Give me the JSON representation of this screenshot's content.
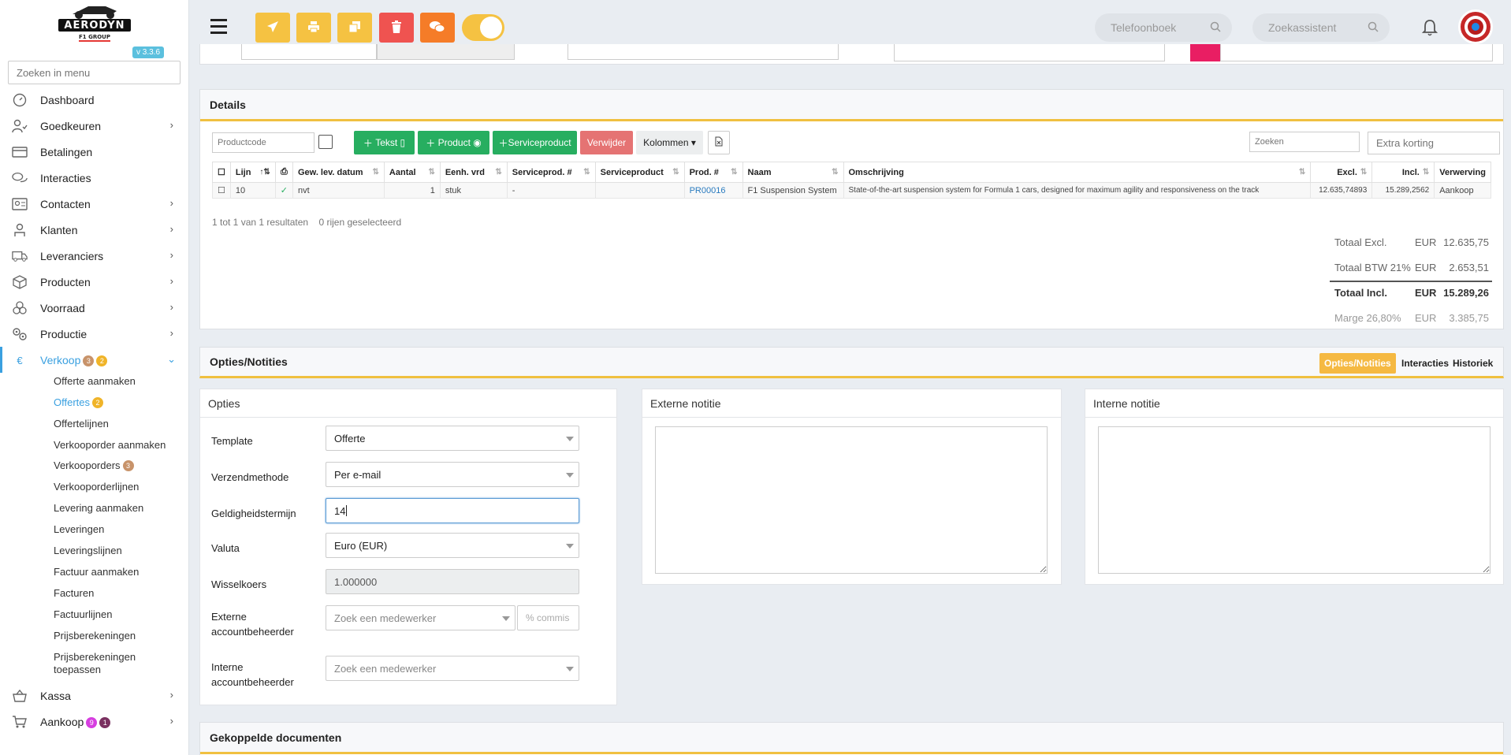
{
  "sidebar": {
    "logo_text": "AERODYN",
    "logo_subtext": "F1 GROUP",
    "version": "v 3.3.6",
    "search_placeholder": "Zoeken in menu",
    "items": [
      {
        "label": "Dashboard",
        "icon": "dashboard-icon"
      },
      {
        "label": "Goedkeuren",
        "icon": "user-check-icon"
      },
      {
        "label": "Betalingen",
        "icon": "card-icon"
      },
      {
        "label": "Interacties",
        "icon": "chat-icon"
      },
      {
        "label": "Contacten",
        "icon": "contact-card-icon"
      },
      {
        "label": "Klanten",
        "icon": "person-icon"
      },
      {
        "label": "Leveranciers",
        "icon": "truck-icon"
      },
      {
        "label": "Producten",
        "icon": "box-icon"
      },
      {
        "label": "Voorraad",
        "icon": "stock-icon"
      },
      {
        "label": "Productie",
        "icon": "gears-icon"
      },
      {
        "label": "Verkoop",
        "icon": "euro-icon",
        "badges": [
          "3",
          "2"
        ]
      }
    ],
    "sub_items": [
      {
        "label": "Offerte aanmaken"
      },
      {
        "label": "Offertes",
        "badge": "2"
      },
      {
        "label": "Offertelijnen"
      },
      {
        "label": "Verkooporder aanmaken"
      },
      {
        "label": "Verkooporders",
        "badge": "3"
      },
      {
        "label": "Verkooporderlijnen"
      },
      {
        "label": "Levering aanmaken"
      },
      {
        "label": "Leveringen"
      },
      {
        "label": "Leveringslijnen"
      },
      {
        "label": "Factuur aanmaken"
      },
      {
        "label": "Facturen"
      },
      {
        "label": "Factuurlijnen"
      },
      {
        "label": "Prijsberekeningen"
      },
      {
        "label": "Prijsberekeningen toepassen"
      }
    ],
    "bottom_items": [
      {
        "label": "Kassa",
        "icon": "basket-icon"
      },
      {
        "label": "Aankoop",
        "icon": "cart-icon",
        "badges": [
          "9",
          "1"
        ]
      }
    ]
  },
  "topbar": {
    "phonebook_placeholder": "Telefoonboek",
    "assistant_placeholder": "Zoekassistent",
    "colors": {
      "yellow": "#f5c242",
      "red": "#ef5350",
      "orange": "#f57c28"
    }
  },
  "details": {
    "title": "Details",
    "productcode_placeholder": "Productcode",
    "btn_tekst": "Tekst",
    "btn_product": "Product",
    "btn_serviceproduct": "Serviceproduct",
    "btn_verwijder": "Verwijder",
    "btn_kolommen": "Kolommen",
    "search_placeholder": "Zoeken",
    "discount_placeholder": "Extra korting",
    "columns": [
      "Lijn",
      "Gew. lev. datum",
      "Aantal",
      "Eenh. vrd",
      "Serviceprod. #",
      "Serviceproduct",
      "Prod. #",
      "Naam",
      "Omschrijving",
      "Excl.",
      "Incl.",
      "Verwerving"
    ],
    "row": {
      "lijn": "10",
      "datum": "nvt",
      "aantal": "1",
      "eenheid": "stuk",
      "serviceprod_nr": "-",
      "serviceproduct": "",
      "prod_nr": "PR00016",
      "naam": "F1 Suspension System",
      "omschrijving": "State-of-the-art suspension system for Formula 1 cars, designed for maximum agility and responsiveness on the track",
      "excl": "12.635,74893",
      "incl": "15.289,2562",
      "verwerving": "Aankoop"
    },
    "result_text": "1 tot 1 van 1 resultaten",
    "selected_text": "0 rijen geselecteerd",
    "totals": [
      {
        "label": "Totaal Excl.",
        "cur": "EUR",
        "value": "12.635,75"
      },
      {
        "label": "Totaal BTW 21%",
        "cur": "EUR",
        "value": "2.653,51"
      },
      {
        "label": "Totaal Incl.",
        "cur": "EUR",
        "value": "15.289,26"
      },
      {
        "label": "Marge 26,80%",
        "cur": "EUR",
        "value": "3.385,75"
      }
    ]
  },
  "options": {
    "title": "Opties/Notities",
    "tabs": [
      "Opties/Notities",
      "Interacties",
      "Historiek"
    ],
    "opties_title": "Opties",
    "external_title": "Externe notitie",
    "internal_title": "Interne notitie",
    "fields": {
      "template_label": "Template",
      "template_value": "Offerte",
      "verzend_label": "Verzendmethode",
      "verzend_value": "Per e-mail",
      "geldig_label": "Geldigheidstermijn",
      "geldig_value": "14",
      "valuta_label": "Valuta",
      "valuta_value": "Euro (EUR)",
      "wissel_label": "Wisselkoers",
      "wissel_value": "1.000000",
      "ext_label_1": "Externe",
      "ext_label_2": "accountbeheerder",
      "ext_placeholder": "Zoek een medewerker",
      "commis_placeholder": "% commis",
      "int_label_1": "Interne",
      "int_label_2": "accountbeheerder",
      "int_placeholder": "Zoek een medewerker"
    }
  },
  "linked": {
    "title": "Gekoppelde documenten"
  }
}
